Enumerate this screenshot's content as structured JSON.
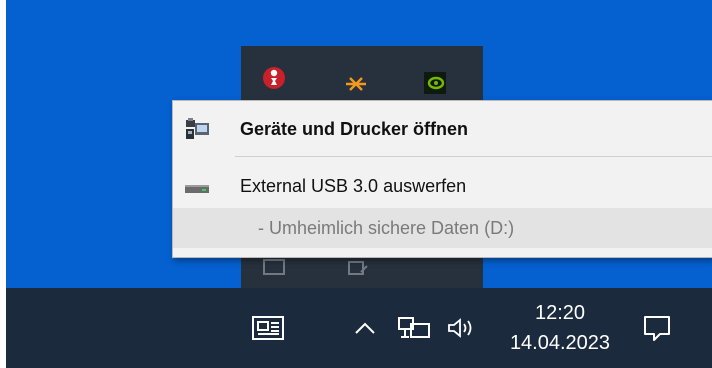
{
  "context_menu": {
    "items": [
      {
        "label": "Geräte und Drucker öffnen",
        "icon": "devices-printers-icon",
        "bold": true
      },
      {
        "label": "External USB 3.0 auswerfen",
        "icon": "usb-drive-icon"
      },
      {
        "label": "- Umheimlich sichere Daten (D:)",
        "disabled": true
      }
    ]
  },
  "taskbar": {
    "time": "12:20",
    "date": "14.04.2023",
    "icons": [
      "news-icon",
      "chevron-up-icon",
      "network-icon",
      "volume-icon",
      "notifications-icon"
    ]
  },
  "tray_overflow": {
    "icons": [
      "app-red-icon",
      "app-orange-icon",
      "nvidia-icon"
    ]
  },
  "colors": {
    "desktop": "#0560d0",
    "taskbar": "#1b2a3c",
    "flyout": "#26313d",
    "menu_bg": "#f2f2f2",
    "menu_hover": "#e3e3e3"
  }
}
